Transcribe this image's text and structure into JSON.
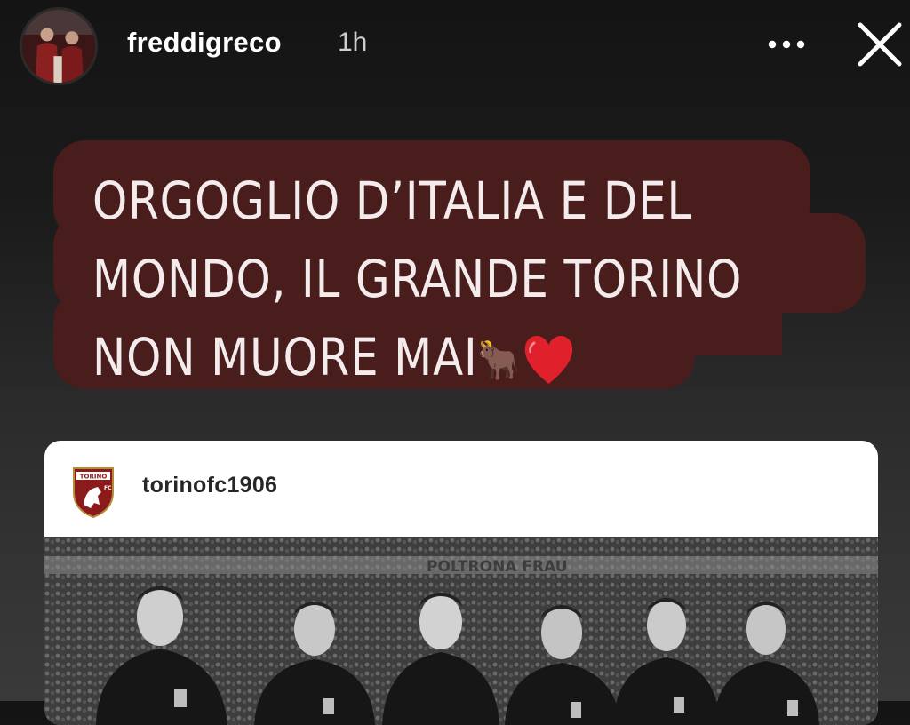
{
  "story_header": {
    "username": "freddigreco",
    "time_ago": "1h",
    "more_icon": "more-horizontal-icon",
    "close_icon": "close-icon"
  },
  "caption": {
    "lines": [
      "ORGOGLIO D’ITALIA E DEL",
      "MONDO, IL GRANDE TORINO",
      "NON MUORE MAI"
    ],
    "emoji": [
      "🐂",
      "❤️"
    ],
    "background_color": "#4a1d1d",
    "text_color": "#f4ecec"
  },
  "shared_post": {
    "username": "torinofc1906",
    "logo_text": [
      "TORINO",
      "FC"
    ],
    "photo_banner_text": "POLTRONA FRAU"
  }
}
